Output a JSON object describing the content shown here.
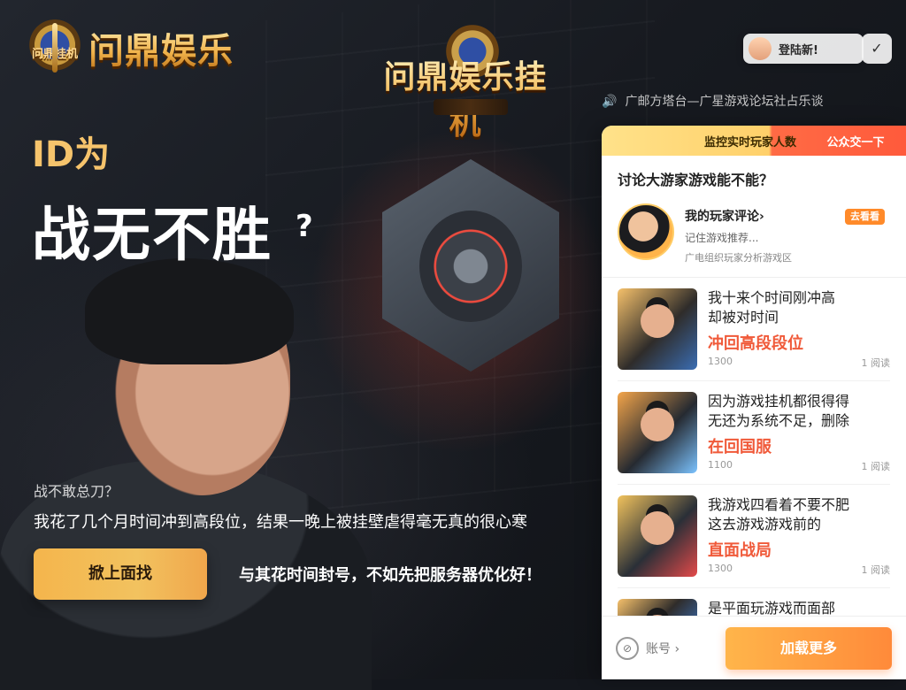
{
  "brand_left": "问鼎娱乐",
  "emblem_left_text": "问鼎挂机",
  "brand_center": "问鼎娱乐挂机",
  "ribbon_text": "",
  "hero": {
    "line1": "ID为",
    "line2": "战无不胜",
    "line2_mark": "?",
    "subq": "战不敢总刀？",
    "desc": "我花了几个月时间冲到高段位，结果一晚上被挂壁虐得毫无真的很心寒",
    "cta": "掀上面找",
    "slogan": "与其花时间封号，不如先把服务器优化好！"
  },
  "top": {
    "pill_text": "登陆新!",
    "check": "✓",
    "tagline": "广邮方塔台—广星游戏论坛社占乐谈"
  },
  "panel": {
    "tab_left": "监控实时玩家人数",
    "tab_right": "公众交一下",
    "title": "讨论大游家游戏能不能？",
    "feature": {
      "name": "我的玩家评论›",
      "tagline": "记住游戏推荐...",
      "small": "广电组织玩家分析游戏区",
      "badge": "去看看"
    },
    "items": [
      {
        "headline": "我十来个时间刚冲高",
        "subheadline": "却被对时间",
        "accent": "冲回高段段位",
        "left": "1300",
        "right": "1 阅读"
      },
      {
        "headline": "因为游戏挂机都很得得",
        "subheadline": "无还为系统不足，删除",
        "accent": "在回国服",
        "left": "1100",
        "right": "1 阅读"
      },
      {
        "headline": "我游戏四看着不要不肥",
        "subheadline": "这去游戏游戏前的",
        "accent": "直面战局",
        "left": "1300",
        "right": "1 阅读"
      },
      {
        "headline": "是平面玩游戏而面部",
        "subheadline": "",
        "accent": "",
        "left": "",
        "right": ""
      }
    ],
    "bottom_left": "账号 ›",
    "bottom_btn": "加载更多"
  }
}
